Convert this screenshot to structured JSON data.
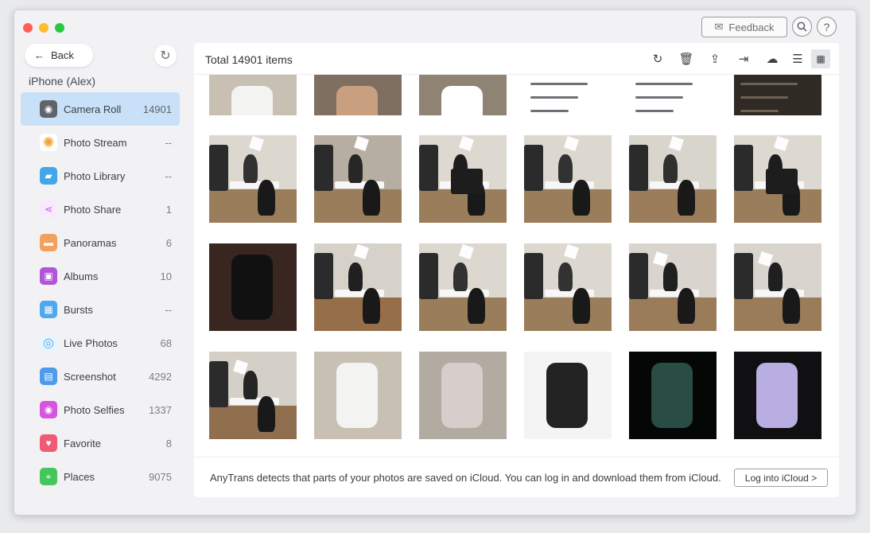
{
  "window": {
    "feedback_label": "Feedback",
    "back_label": "Back",
    "device_name": "iPhone (Alex)"
  },
  "sidebar": {
    "items": [
      {
        "label": "Camera Roll",
        "count": "14901",
        "icon": "camera-icon",
        "color": "#606368"
      },
      {
        "label": "Photo Stream",
        "count": "--",
        "icon": "flower-icon",
        "color": "#f2a235"
      },
      {
        "label": "Photo Library",
        "count": "--",
        "icon": "folder-icon",
        "color": "#42a6e8"
      },
      {
        "label": "Photo Share",
        "count": "1",
        "icon": "share-icon",
        "color": "#bb57e0"
      },
      {
        "label": "Panoramas",
        "count": "6",
        "icon": "panorama-icon",
        "color": "#f0a15d"
      },
      {
        "label": "Albums",
        "count": "10",
        "icon": "albums-icon",
        "color": "#b154d8"
      },
      {
        "label": "Bursts",
        "count": "--",
        "icon": "stack-icon",
        "color": "#4da8ef"
      },
      {
        "label": "Live Photos",
        "count": "68",
        "icon": "live-photo-icon",
        "color": "#51a8ec"
      },
      {
        "label": "Screenshot",
        "count": "4292",
        "icon": "screenshot-icon",
        "color": "#4e9be9"
      },
      {
        "label": "Photo Selfies",
        "count": "1337",
        "icon": "selfie-icon",
        "color": "#d555df"
      },
      {
        "label": "Favorite",
        "count": "8",
        "icon": "heart-icon",
        "color": "#f05a74"
      },
      {
        "label": "Places",
        "count": "9075",
        "icon": "map-pin-icon",
        "color": "#43c75b"
      }
    ]
  },
  "main": {
    "total": "Total 14901 items",
    "notice": "AnyTrans detects that parts of your photos are saved on iCloud. You can log in and download them from iCloud.",
    "login_label": "Log into iCloud >"
  },
  "toolbar": {
    "icons": [
      "refresh-icon",
      "trash-icon",
      "export-icon",
      "import-icon",
      "cloud-upload-icon",
      "list-view-icon",
      "grid-view-icon"
    ]
  },
  "colors": {
    "accent": "#c8e1f8",
    "window_bg": "#f2f2f4",
    "content_bg": "#ffffff"
  },
  "photos": {
    "first_row": [
      "coffee-cup",
      "cat",
      "airpods",
      "screenshot",
      "screenshot",
      "dark-screenshot"
    ],
    "grid": [
      [
        "studio-interview",
        "camera-operator",
        "studio-interview-monitor",
        "studio-interview",
        "studio-interview-crew",
        "studio-interview-monitor"
      ],
      [
        "apple-watch",
        "studio-camera-crew",
        "studio-interview",
        "studio-interview",
        "studio-lighting",
        "studio-lighting"
      ],
      [
        "studio-lighting-crew",
        "coffee-cup",
        "kitchen",
        "camera-lens",
        "iphone-11-pro",
        "iphone-11"
      ]
    ]
  }
}
